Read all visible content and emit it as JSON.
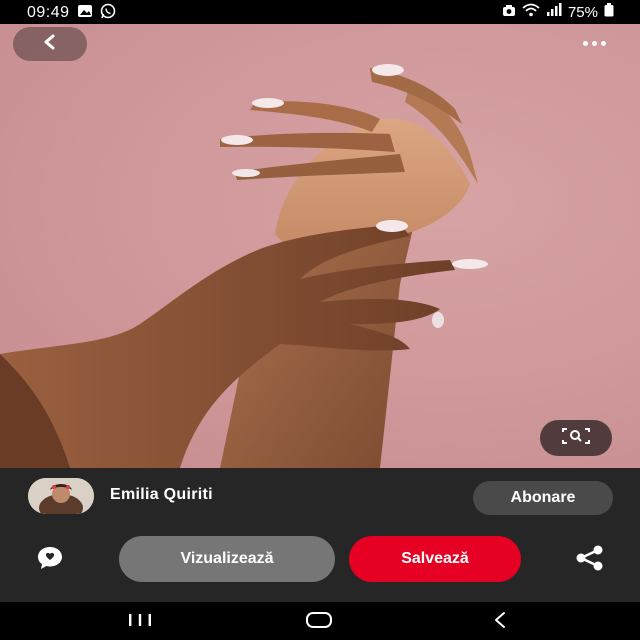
{
  "status_bar": {
    "time": "09:49",
    "battery": "75%",
    "left_icons": [
      "gallery-icon",
      "whatsapp-icon"
    ],
    "right_icons": [
      "camera-icon",
      "wifi-icon",
      "signal-icon",
      "battery-icon"
    ]
  },
  "pin": {
    "image_description_icon": "hands-photo",
    "back_icon": "chevron-left-icon",
    "more_icon": "more-dots-icon",
    "lens_icon": "visual-search-icon"
  },
  "creator": {
    "name": "Emilia Quiriti",
    "follow_label": "Abonare"
  },
  "actions": {
    "view_label": "Vizualizează",
    "save_label": "Salvează",
    "comment_icon": "comment-icon",
    "share_icon": "share-icon"
  },
  "nav": {
    "recents_icon": "recents-icon",
    "home_icon": "home-icon",
    "back_icon": "back-icon"
  },
  "colors": {
    "save_red": "#e60023",
    "panel_bg": "#262626",
    "photo_bg": "#cf989a"
  }
}
